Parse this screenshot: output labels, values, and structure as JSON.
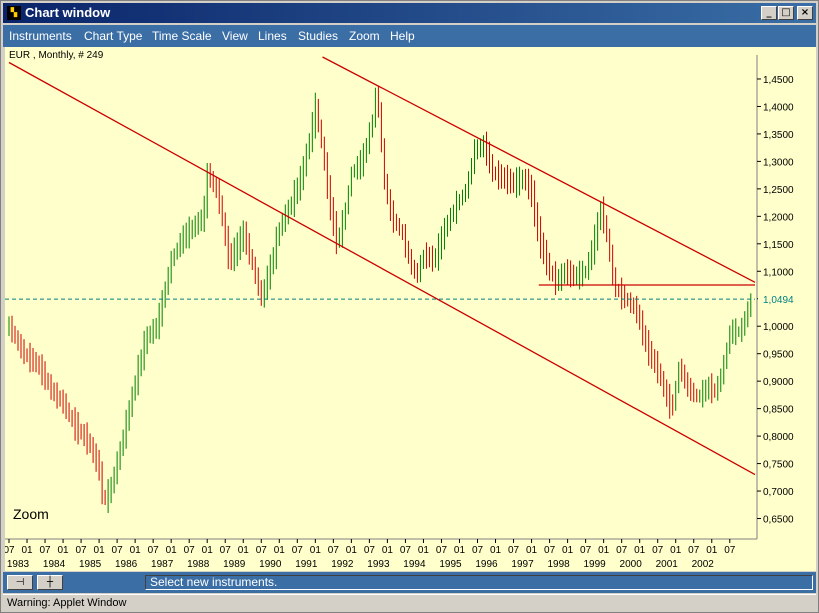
{
  "window": {
    "title": "Chart window",
    "icon": "chart-app-icon",
    "controls": {
      "minimize": "_",
      "maximize": "□",
      "close": "×"
    }
  },
  "menu": [
    "Instruments",
    "Chart Type",
    "Time Scale",
    "View",
    "Lines",
    "Studies",
    "Zoom",
    "Help"
  ],
  "chart_data": {
    "type": "ohlc-bar",
    "header": "EUR , Monthly, # 249",
    "zoom_label": "Zoom",
    "current_price_label": "1,0494",
    "current_price": 1.0494,
    "ylim": [
      0.62,
      1.49
    ],
    "y_ticks": [
      "1,4500",
      "1,4000",
      "1,3500",
      "1,3000",
      "1,2500",
      "1,2000",
      "1,1500",
      "1,1000",
      "1,0500",
      "1,0000",
      "0,9500",
      "0,9000",
      "0,8500",
      "0,8000",
      "0,7500",
      "0,7000",
      "0,6500"
    ],
    "x_month_ticks": [
      "07",
      "01",
      "07",
      "01",
      "07",
      "01",
      "07",
      "01",
      "07",
      "01",
      "07",
      "01",
      "07",
      "01",
      "07",
      "01",
      "07",
      "01",
      "07",
      "01",
      "07",
      "01",
      "07",
      "01",
      "07",
      "01",
      "07",
      "01",
      "07",
      "01",
      "07",
      "01",
      "07",
      "01",
      "07",
      "01",
      "07",
      "01",
      "07",
      "01",
      "07"
    ],
    "x_year_labels": [
      "1983",
      "1984",
      "1985",
      "1986",
      "1987",
      "1988",
      "1989",
      "1990",
      "1991",
      "1992",
      "1993",
      "1994",
      "1995",
      "1996",
      "1997",
      "1998",
      "1999",
      "2000",
      "2001",
      "2002"
    ],
    "x_start": 1982.5,
    "x_end": 2003.2,
    "price_path": [
      [
        1982.5,
        1.0
      ],
      [
        1982.9,
        0.95
      ],
      [
        1983.3,
        0.93
      ],
      [
        1983.7,
        0.88
      ],
      [
        1984.0,
        0.86
      ],
      [
        1984.3,
        0.82
      ],
      [
        1984.7,
        0.79
      ],
      [
        1985.0,
        0.74
      ],
      [
        1985.1,
        0.68
      ],
      [
        1985.3,
        0.7
      ],
      [
        1985.6,
        0.78
      ],
      [
        1986.0,
        0.9
      ],
      [
        1986.3,
        0.98
      ],
      [
        1986.6,
        1.0
      ],
      [
        1987.0,
        1.12
      ],
      [
        1987.3,
        1.16
      ],
      [
        1987.6,
        1.18
      ],
      [
        1987.9,
        1.2
      ],
      [
        1988.0,
        1.28
      ],
      [
        1988.3,
        1.24
      ],
      [
        1988.6,
        1.12
      ],
      [
        1988.8,
        1.14
      ],
      [
        1989.0,
        1.17
      ],
      [
        1989.3,
        1.1
      ],
      [
        1989.5,
        1.05
      ],
      [
        1989.8,
        1.12
      ],
      [
        1990.0,
        1.18
      ],
      [
        1990.3,
        1.22
      ],
      [
        1990.6,
        1.27
      ],
      [
        1990.9,
        1.36
      ],
      [
        1991.0,
        1.4
      ],
      [
        1991.2,
        1.32
      ],
      [
        1991.4,
        1.22
      ],
      [
        1991.6,
        1.15
      ],
      [
        1991.8,
        1.2
      ],
      [
        1992.0,
        1.28
      ],
      [
        1992.3,
        1.3
      ],
      [
        1992.6,
        1.38
      ],
      [
        1992.7,
        1.44
      ],
      [
        1992.9,
        1.27
      ],
      [
        1993.1,
        1.2
      ],
      [
        1993.4,
        1.17
      ],
      [
        1993.6,
        1.12
      ],
      [
        1993.8,
        1.09
      ],
      [
        1994.0,
        1.13
      ],
      [
        1994.3,
        1.12
      ],
      [
        1994.6,
        1.18
      ],
      [
        1994.9,
        1.22
      ],
      [
        1995.2,
        1.25
      ],
      [
        1995.4,
        1.32
      ],
      [
        1995.7,
        1.33
      ],
      [
        1995.9,
        1.28
      ],
      [
        1996.2,
        1.27
      ],
      [
        1996.5,
        1.26
      ],
      [
        1996.8,
        1.27
      ],
      [
        1997.0,
        1.24
      ],
      [
        1997.2,
        1.16
      ],
      [
        1997.5,
        1.1
      ],
      [
        1997.7,
        1.08
      ],
      [
        1997.9,
        1.1
      ],
      [
        1998.2,
        1.09
      ],
      [
        1998.5,
        1.1
      ],
      [
        1998.8,
        1.17
      ],
      [
        1998.9,
        1.22
      ],
      [
        1999.1,
        1.16
      ],
      [
        1999.3,
        1.07
      ],
      [
        1999.6,
        1.05
      ],
      [
        1999.9,
        1.03
      ],
      [
        2000.2,
        0.96
      ],
      [
        2000.5,
        0.92
      ],
      [
        2000.8,
        0.86
      ],
      [
        2000.9,
        0.85
      ],
      [
        2001.1,
        0.93
      ],
      [
        2001.3,
        0.89
      ],
      [
        2001.6,
        0.87
      ],
      [
        2001.9,
        0.89
      ],
      [
        2002.1,
        0.88
      ],
      [
        2002.3,
        0.92
      ],
      [
        2002.5,
        0.99
      ],
      [
        2002.8,
        0.99
      ],
      [
        2003.0,
        1.03
      ],
      [
        2003.1,
        1.05
      ]
    ],
    "trend_lines": [
      {
        "color": "#cc0000",
        "from": [
          1982.5,
          1.48
        ],
        "to": [
          2003.2,
          0.73
        ]
      },
      {
        "color": "#cc0000",
        "from": [
          1991.2,
          1.49
        ],
        "to": [
          2003.2,
          1.08
        ]
      },
      {
        "color": "#cc0000",
        "from": [
          1997.2,
          1.075
        ],
        "to": [
          2003.2,
          1.075
        ]
      }
    ],
    "colors": {
      "background": "#ffffcc",
      "up_bar": "#008000",
      "down_bar": "#cc0000",
      "line": "#cc0000",
      "price_line": "#008080"
    }
  },
  "toolbar": {
    "tool_1_icon": "pin-icon",
    "tool_2_icon": "crosshair-icon",
    "status": "Select new instruments."
  },
  "statusbar": {
    "warning": "Warning: Applet Window"
  }
}
